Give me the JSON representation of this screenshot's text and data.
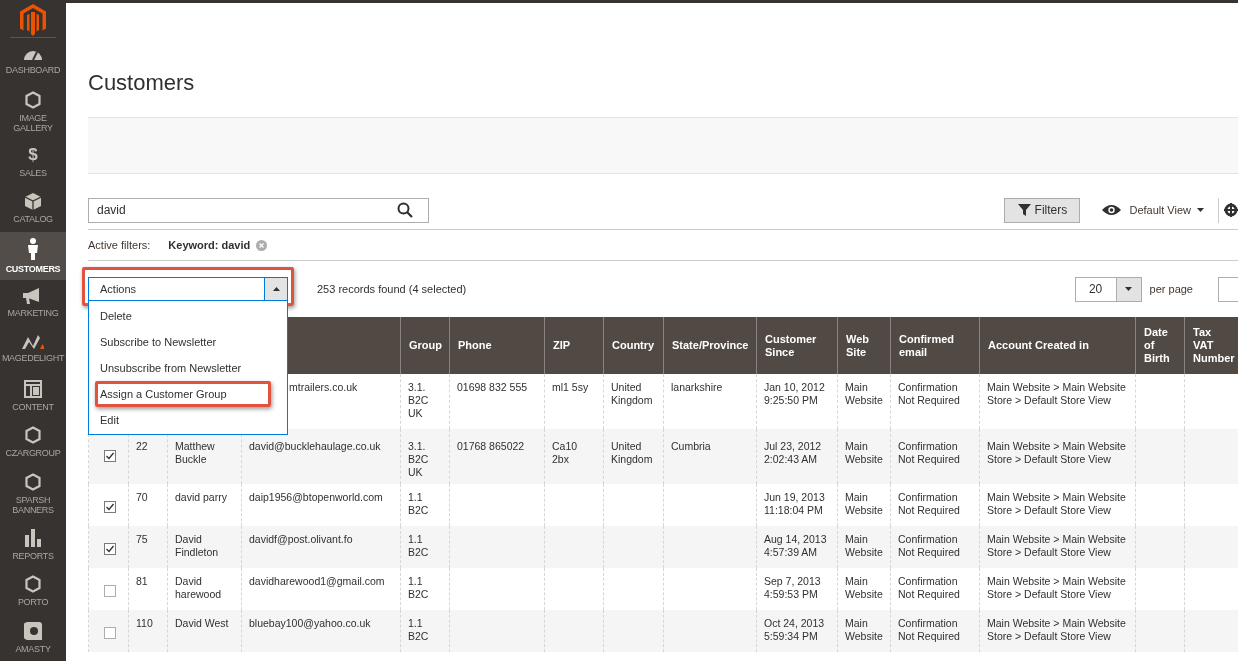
{
  "sidebar": {
    "items": [
      {
        "label": "DASHBOARD",
        "selected": false
      },
      {
        "label": "IMAGE GALLERY",
        "selected": false
      },
      {
        "label": "SALES",
        "selected": false,
        "glyph": "$"
      },
      {
        "label": "CATALOG",
        "selected": false
      },
      {
        "label": "CUSTOMERS",
        "selected": true
      },
      {
        "label": "MARKETING",
        "selected": false
      },
      {
        "label": "MAGEDELIGHT",
        "selected": false
      },
      {
        "label": "CONTENT",
        "selected": false
      },
      {
        "label": "CZARGROUP",
        "selected": false
      },
      {
        "label": "SPARSH BANNERS",
        "selected": false
      },
      {
        "label": "REPORTS",
        "selected": false
      },
      {
        "label": "PORTO",
        "selected": false
      },
      {
        "label": "AMASTY",
        "selected": false
      }
    ]
  },
  "page_title": "Customers",
  "search": {
    "value": "david"
  },
  "filters_button": "Filters",
  "view_switcher": "Default View",
  "active_filters": {
    "label": "Active filters:",
    "keyword": "Keyword: david"
  },
  "actions": {
    "label": "Actions",
    "expanded": true,
    "options": [
      {
        "label": "Delete",
        "highlighted": false
      },
      {
        "label": "Subscribe to Newsletter",
        "highlighted": false
      },
      {
        "label": "Unsubscribe from Newsletter",
        "highlighted": false
      },
      {
        "label": "Assign a Customer Group",
        "highlighted": true
      },
      {
        "label": "Edit",
        "highlighted": false
      }
    ]
  },
  "records": "253 records found (4 selected)",
  "per_page": {
    "value": "20",
    "label": "per page"
  },
  "table": {
    "columns": [
      "Group",
      "Phone",
      "ZIP",
      "Country",
      "State/Province",
      "Customer Since",
      "Web Site",
      "Confirmed email",
      "Account Created in",
      "Date of Birth",
      "Tax VAT Number"
    ],
    "rows": [
      {
        "email": "mtrailers.co.uk",
        "group": "3.1.\nB2C\nUK",
        "phone": "01698 832 555",
        "zip": "ml1 5sy",
        "country": "United\nKingdom",
        "state": "lanarkshire",
        "since": "Jan 10, 2012\n9:25:50 PM",
        "website": "Main\nWebsite",
        "confirmed": "Confirmation\nNot Required",
        "created": "Main Website > Main Website\nStore > Default Store View"
      },
      {
        "checked": true,
        "id": "22",
        "name": "Matthew\nBuckle",
        "email": "david@bucklehaulage.co.uk",
        "group": "3.1.\nB2C\nUK",
        "phone": "01768 865022",
        "zip": "Ca10 2bx",
        "country": "United\nKingdom",
        "state": "Cumbria",
        "since": "Jul 23, 2012\n2:02:43 AM",
        "website": "Main\nWebsite",
        "confirmed": "Confirmation\nNot Required",
        "created": "Main Website > Main Website\nStore > Default Store View"
      },
      {
        "checked": true,
        "id": "70",
        "name": "david parry",
        "email": "daip1956@btopenworld.com",
        "group": "1.1\nB2C",
        "since": "Jun 19, 2013\n11:18:04 PM",
        "website": "Main\nWebsite",
        "confirmed": "Confirmation\nNot Required",
        "created": "Main Website > Main Website\nStore > Default Store View"
      },
      {
        "checked": true,
        "id": "75",
        "name": "David\nFindleton",
        "email": "davidf@post.olivant.fo",
        "group": "1.1\nB2C",
        "since": "Aug 14, 2013\n4:57:39 AM",
        "website": "Main\nWebsite",
        "confirmed": "Confirmation\nNot Required",
        "created": "Main Website > Main Website\nStore > Default Store View"
      },
      {
        "checked": false,
        "id": "81",
        "name": "David\nharewood",
        "email": "davidharewood1@gmail.com",
        "group": "1.1\nB2C",
        "since": "Sep 7, 2013\n4:59:53 PM",
        "website": "Main\nWebsite",
        "confirmed": "Confirmation\nNot Required",
        "created": "Main Website > Main Website\nStore > Default Store View"
      },
      {
        "checked": false,
        "id": "110",
        "name": "David West",
        "email": "bluebay100@yahoo.co.uk",
        "group": "1.1\nB2C",
        "since": "Oct 24, 2013\n5:59:34 PM",
        "website": "Main\nWebsite",
        "confirmed": "Confirmation\nNot Required",
        "created": "Main Website > Main Website\nStore > Default Store View"
      }
    ]
  }
}
